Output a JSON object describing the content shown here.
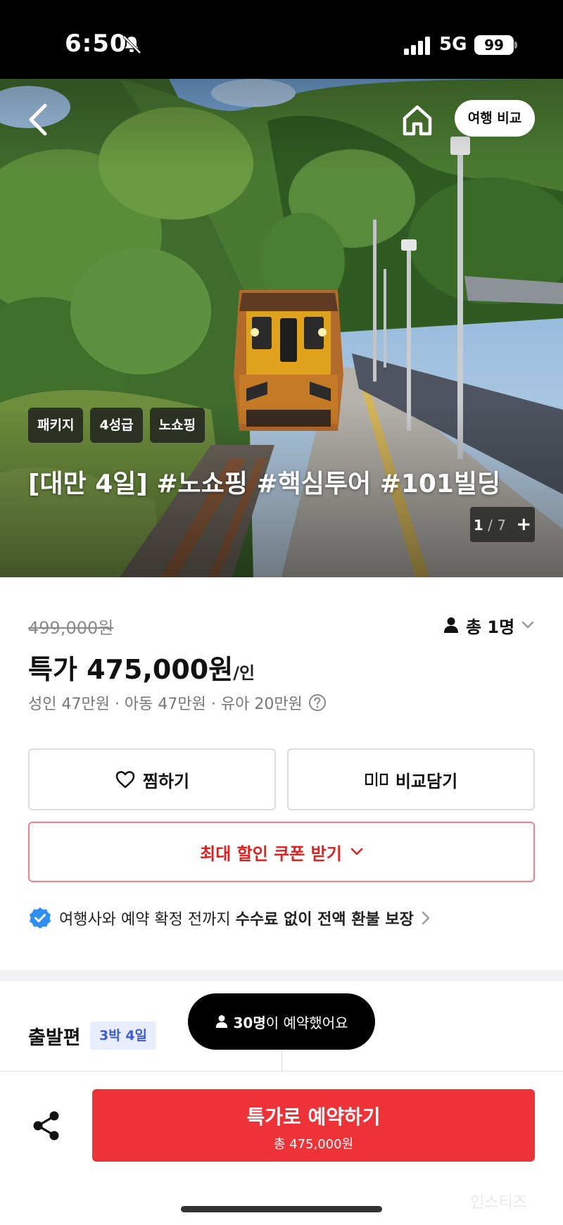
{
  "status_bar": {
    "time": "6:50",
    "network": "5G",
    "battery": "99"
  },
  "hero": {
    "compare_label": "여행 비교",
    "tags": [
      "패키지",
      "4성급",
      "노쇼핑"
    ],
    "title": "[대만 4일] #노쇼핑 #핵심투어 #101빌딩",
    "image_index": "1",
    "image_total": "7",
    "image_more": "+"
  },
  "pricing": {
    "original_price": "499,000원",
    "people_label": "총 1명",
    "special_price": "특가 475,000원",
    "per_person": "/인",
    "breakdown": "성인 47만원 · 아동 47만원 · 유아 20만원"
  },
  "actions": {
    "wishlist_label": "찜하기",
    "compare_add_label": "비교담기",
    "coupon_label": "최대 할인 쿠폰 받기"
  },
  "refund": {
    "prefix": "여행사와 예약 확정 전까지 ",
    "emphasis": "수수료 없이 전액 환불 보장"
  },
  "departure": {
    "title": "출발편",
    "duration": "3박 4일"
  },
  "toast": {
    "count": "30명",
    "suffix": "이 예약했어요"
  },
  "bottom": {
    "reserve_label": "특가로 예약하기",
    "reserve_total": "총 475,000원",
    "watermark": "인스티즈"
  },
  "colors": {
    "accent_red": "#ee3338",
    "coupon_red": "#e02020",
    "badge_blue": "#3b5bdb",
    "verified_blue": "#2f8ff0"
  }
}
